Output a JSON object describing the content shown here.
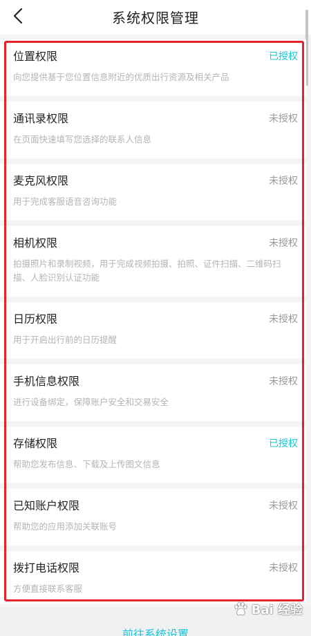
{
  "header": {
    "title": "系统权限管理"
  },
  "permissions": [
    {
      "title": "位置权限",
      "status": "已授权",
      "desc": "向您提供基于您位置信息附近的优质出行资源及相关产品"
    },
    {
      "title": "通讯录权限",
      "status": "未授权",
      "desc": "在页面快速填写您选择的联系人信息"
    },
    {
      "title": "麦克风权限",
      "status": "未授权",
      "desc": "用于完成客服语音咨询功能"
    },
    {
      "title": "相机权限",
      "status": "未授权",
      "desc": "拍摄照片和录制视频，用于完成视频拍摄、拍照、证件扫描、二维码扫描、人脸识别认证功能"
    },
    {
      "title": "日历权限",
      "status": "未授权",
      "desc": "用于开启出行前的日历提醒"
    },
    {
      "title": "手机信息权限",
      "status": "未授权",
      "desc": "进行设备绑定，保障账户安全和交易安全"
    },
    {
      "title": "存储权限",
      "status": "已授权",
      "desc": "帮助您发布信息、下载及上传图文信息"
    },
    {
      "title": "已知账户权限",
      "status": "未授权",
      "desc": "帮助您的应用添加关联账号"
    },
    {
      "title": "拨打电话权限",
      "status": "未授权",
      "desc": "方便直接联系客服"
    }
  ],
  "footer": {
    "button_label": "前往系统设置"
  },
  "watermark": {
    "text": "Bai 经验"
  },
  "colors": {
    "granted": "#19c5d6",
    "not_granted": "#999999",
    "highlight": "#e8202a"
  }
}
